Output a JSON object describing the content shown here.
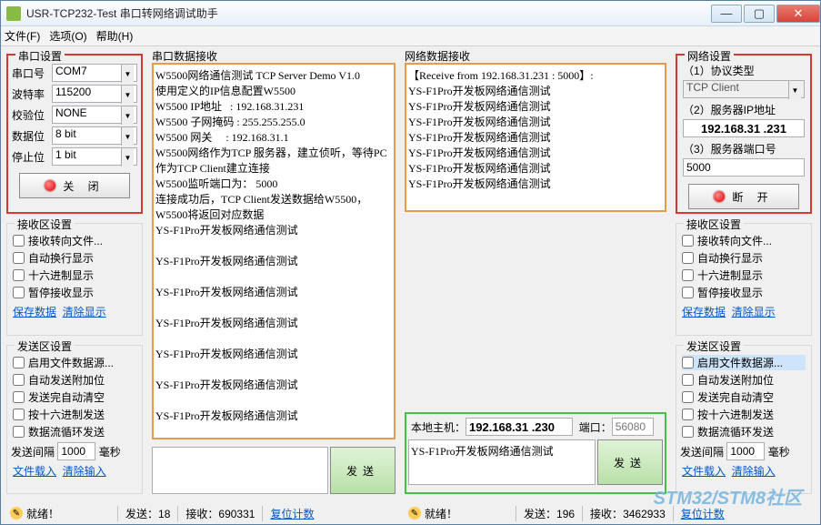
{
  "window": {
    "title": "USR-TCP232-Test 串口转网络调试助手"
  },
  "winbtns": {
    "min": "—",
    "max": "▢",
    "close": "✕"
  },
  "menu": {
    "file": "文件(F)",
    "options": "选项(O)",
    "help": "帮助(H)"
  },
  "serial": {
    "group": "串口设置",
    "port_lbl": "串口号",
    "port": "COM7",
    "baud_lbl": "波特率",
    "baud": "115200",
    "parity_lbl": "校验位",
    "parity": "NONE",
    "databits_lbl": "数据位",
    "databits": "8 bit",
    "stopbits_lbl": "停止位",
    "stopbits": "1 bit",
    "close_btn": "关  闭"
  },
  "recv_set": {
    "group": "接收区设置",
    "c1": "接收转向文件...",
    "c2": "自动换行显示",
    "c3": "十六进制显示",
    "c4": "暂停接收显示",
    "save": "保存数据",
    "clear": "清除显示"
  },
  "send_set": {
    "group": "发送区设置",
    "c1": "启用文件数据源...",
    "c2": "自动发送附加位",
    "c3": "发送完自动清空",
    "c4": "按十六进制发送",
    "c5": "数据流循环发送",
    "interval_lbl": "发送间隔",
    "interval_val": "1000",
    "interval_unit": "毫秒",
    "load": "文件载入",
    "clear": "清除输入"
  },
  "serial_recv": {
    "title": "串口数据接收",
    "content": "W5500网络通信测试 TCP Server Demo V1.0\n使用定义的IP信息配置W5500\nW5500 IP地址   : 192.168.31.231\nW5500 子网掩码 : 255.255.255.0\nW5500 网关     : 192.168.31.1\nW5500网络作为TCP 服务器，建立侦听，等待PC作为TCP Client建立连接\nW5500监听端口为： 5000\n连接成功后，TCP Client发送数据给W5500，W5500将返回对应数据\nYS-F1Pro开发板网络通信测试\n\nYS-F1Pro开发板网络通信测试\n\nYS-F1Pro开发板网络通信测试\n\nYS-F1Pro开发板网络通信测试\n\nYS-F1Pro开发板网络通信测试\n\nYS-F1Pro开发板网络通信测试\n\nYS-F1Pro开发板网络通信测试"
  },
  "net_recv": {
    "title": "网络数据接收",
    "content": "【Receive from 192.168.31.231 : 5000】:\nYS-F1Pro开发板网络通信测试\nYS-F1Pro开发板网络通信测试\nYS-F1Pro开发板网络通信测试\nYS-F1Pro开发板网络通信测试\nYS-F1Pro开发板网络通信测试\nYS-F1Pro开发板网络通信测试\nYS-F1Pro开发板网络通信测试"
  },
  "net": {
    "group": "网络设置",
    "proto_lbl": "（1）协议类型",
    "proto": "TCP Client",
    "ip_lbl": "（2）服务器IP地址",
    "ip": "192.168.31 .231",
    "port_lbl": "（3）服务器端口号",
    "port": "5000",
    "disconnect_btn": "断  开"
  },
  "send": {
    "btn": "发送",
    "host_lbl": "本地主机：",
    "host_val": "192.168.31 .230",
    "port_lbl": "端口：",
    "port_val": "56080",
    "input_text": "YS-F1Pro开发板网络通信测试"
  },
  "status": {
    "ready": "就绪！",
    "send1_lbl": "发送：",
    "send1": "18",
    "recv1_lbl": "接收：",
    "recv1": "690331",
    "reset": "复位计数",
    "send2_lbl": "发送：",
    "send2": "196",
    "recv2_lbl": "接收：",
    "recv2": "3462933"
  },
  "watermark": "STM32/STM8社区"
}
